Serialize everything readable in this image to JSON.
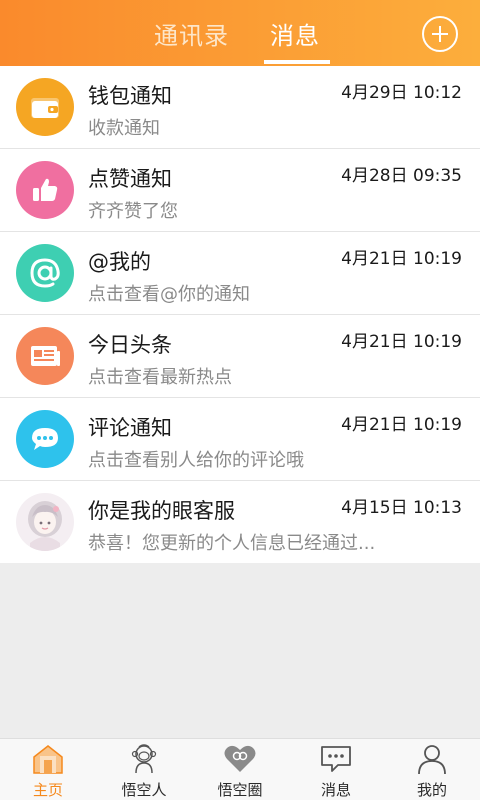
{
  "header": {
    "tabs": [
      {
        "label": "通讯录",
        "active": false
      },
      {
        "label": "消息",
        "active": true
      }
    ],
    "add_icon": "plus-circle-icon",
    "gradient_colors": [
      "#fa8a2c",
      "#fcae3c"
    ]
  },
  "messages": [
    {
      "title": "钱包通知",
      "subtitle": "收款通知",
      "time": "4月29日 10:12",
      "icon": "wallet-icon",
      "color": "#f5a623"
    },
    {
      "title": "点赞通知",
      "subtitle": "齐齐赞了您",
      "time": "4月28日 09:35",
      "icon": "thumbs-up-icon",
      "color": "#f06fa0"
    },
    {
      "title": "@我的",
      "subtitle": "点击查看@你的通知",
      "time": "4月21日 10:19",
      "icon": "at-icon",
      "color": "#3ecfb2"
    },
    {
      "title": "今日头条",
      "subtitle": "点击查看最新热点",
      "time": "4月21日 10:19",
      "icon": "newspaper-icon",
      "color": "#f5875a"
    },
    {
      "title": "评论通知",
      "subtitle": "点击查看别人给你的评论哦",
      "time": "4月21日 10:19",
      "icon": "comment-icon",
      "color": "#2ec2ec"
    },
    {
      "title": "你是我的眼客服",
      "subtitle": "恭喜！您更新的个人信息已经通过...",
      "time": "4月15日 10:13",
      "icon": "user-avatar-icon",
      "color": "#f4eef2"
    }
  ],
  "bottom_nav": [
    {
      "label": "主页",
      "icon": "home-icon",
      "active": true
    },
    {
      "label": "悟空人",
      "icon": "monkey-icon",
      "active": false
    },
    {
      "label": "悟空圈",
      "icon": "heart-circle-icon",
      "active": false
    },
    {
      "label": "消息",
      "icon": "message-icon",
      "active": false
    },
    {
      "label": "我的",
      "icon": "person-icon",
      "active": false
    }
  ],
  "accent_color": "#f5891d"
}
